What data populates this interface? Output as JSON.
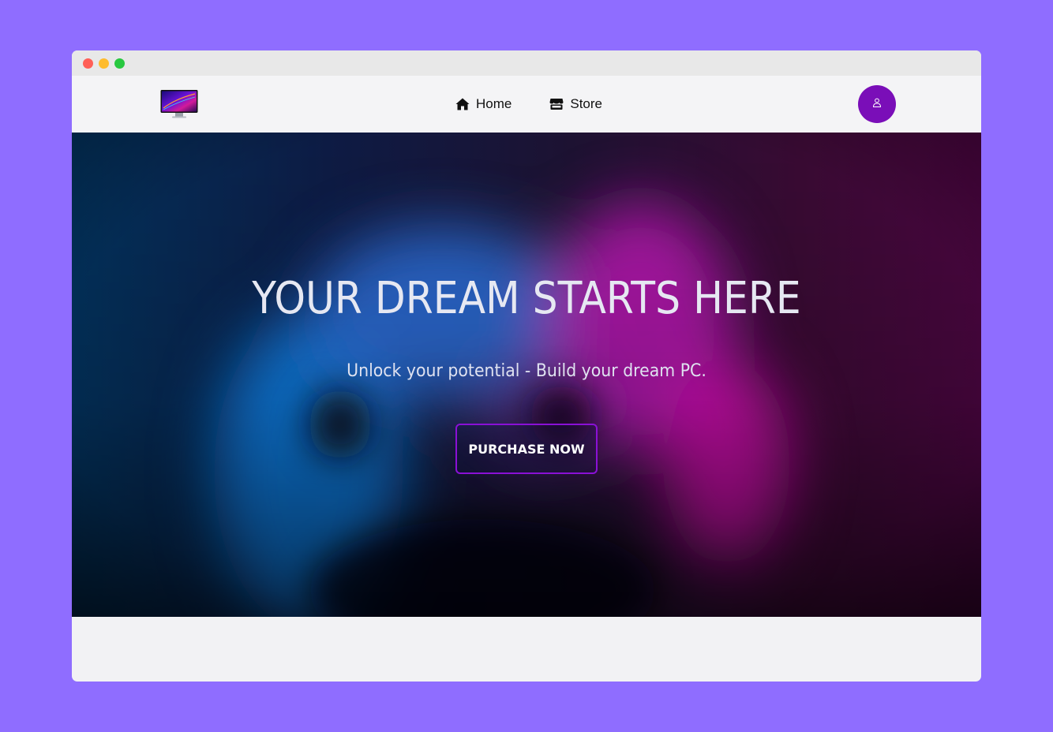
{
  "nav": {
    "logo_icon": "monitor-logo-icon",
    "links": [
      {
        "label": "Home",
        "icon": "home-icon"
      },
      {
        "label": "Store",
        "icon": "store-icon"
      }
    ],
    "profile_icon": "user-icon",
    "profile_color": "#7a0eb8"
  },
  "hero": {
    "title": "YOUR DREAM STARTS HERE",
    "subtitle": "Unlock your potential - Build your dream PC.",
    "cta_label": "PURCHASE NOW",
    "cta_border_color": "#8a10d6"
  },
  "colors": {
    "page_background": "#8f6dff",
    "hero_blue": "#0a8cff",
    "hero_magenta": "#e010c0"
  }
}
